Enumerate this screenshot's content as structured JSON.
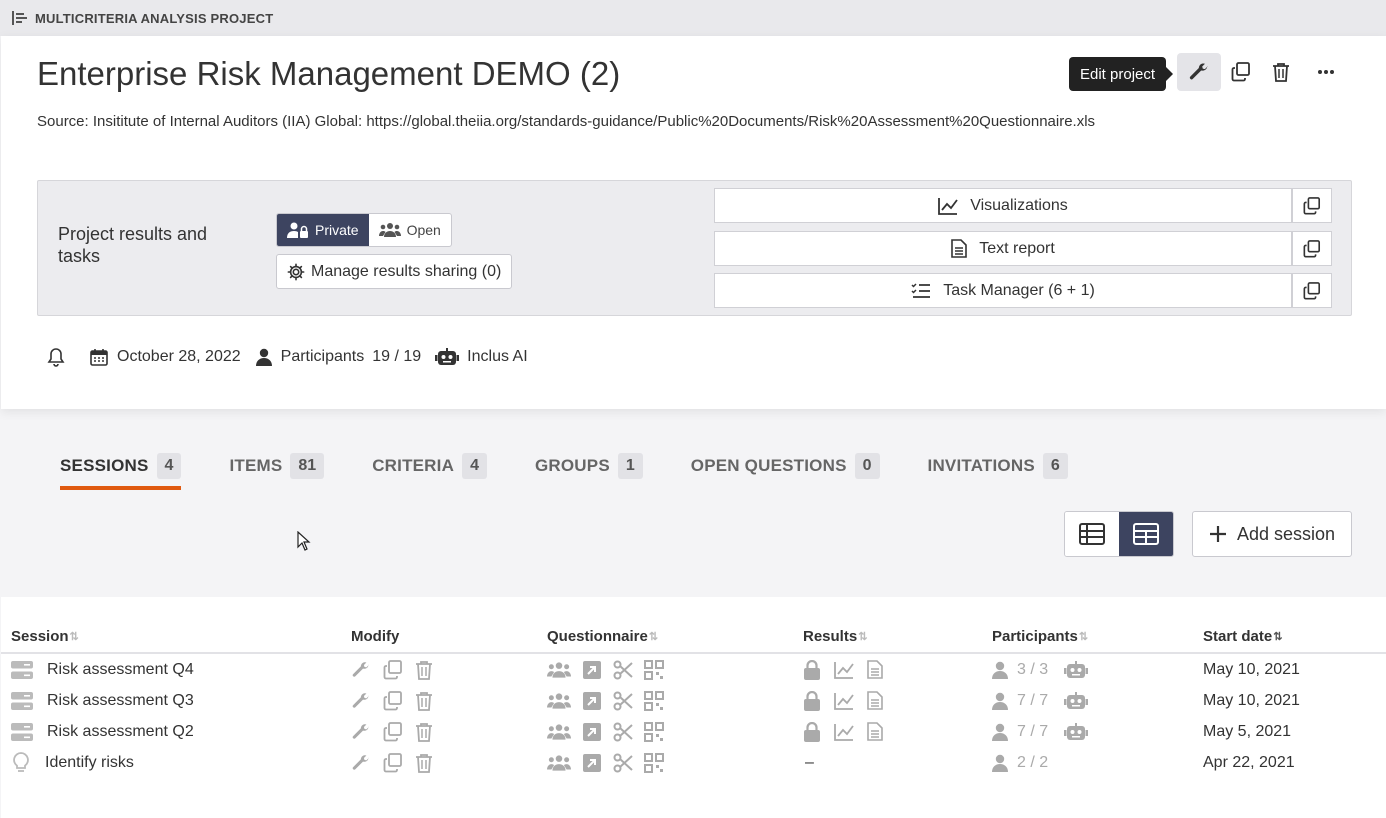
{
  "topbar": {
    "title": "MULTICRITERIA ANALYSIS PROJECT"
  },
  "project": {
    "title": "Enterprise Risk Management DEMO (2)",
    "source": "Source: Insititute of Internal Auditors (IIA) Global: https://global.theiia.org/standards-guidance/Public%20Documents/Risk%20Assessment%20Questionnaire.xls",
    "edit_tooltip": "Edit project",
    "results": {
      "title": "Project results and tasks",
      "private_label": "Private",
      "open_label": "Open",
      "manage_label": "Manage results sharing (0)",
      "visualizations_label": "Visualizations",
      "text_report_label": "Text report",
      "task_manager_label": "Task Manager (6 + 1)"
    },
    "meta": {
      "date": "October 28, 2022",
      "participants_label": "Participants",
      "participants_count": "19 / 19",
      "ai_label": "Inclus AI"
    }
  },
  "tabs": [
    {
      "label": "SESSIONS",
      "count": "4"
    },
    {
      "label": "ITEMS",
      "count": "81"
    },
    {
      "label": "CRITERIA",
      "count": "4"
    },
    {
      "label": "GROUPS",
      "count": "1"
    },
    {
      "label": "OPEN QUESTIONS",
      "count": "0"
    },
    {
      "label": "INVITATIONS",
      "count": "6"
    }
  ],
  "actions": {
    "add_session_label": "Add session"
  },
  "table": {
    "headers": {
      "session": "Session",
      "modify": "Modify",
      "questionnaire": "Questionnaire",
      "results": "Results",
      "participants": "Participants",
      "start_date": "Start date"
    },
    "rows": [
      {
        "name": "Risk assessment Q4",
        "participants": "3 / 3",
        "start_date": "May 10, 2021",
        "results": ""
      },
      {
        "name": "Risk assessment Q3",
        "participants": "7 / 7",
        "start_date": "May 10, 2021",
        "results": ""
      },
      {
        "name": "Risk assessment Q2",
        "participants": "7 / 7",
        "start_date": "May 5, 2021",
        "results": ""
      },
      {
        "name": "Identify risks",
        "participants": "2 / 2",
        "start_date": "Apr 22, 2021",
        "results": "–"
      }
    ]
  },
  "colors": {
    "accent": "#e05a10",
    "dark": "#3d4460",
    "icon_grey": "#aaaaaa"
  }
}
